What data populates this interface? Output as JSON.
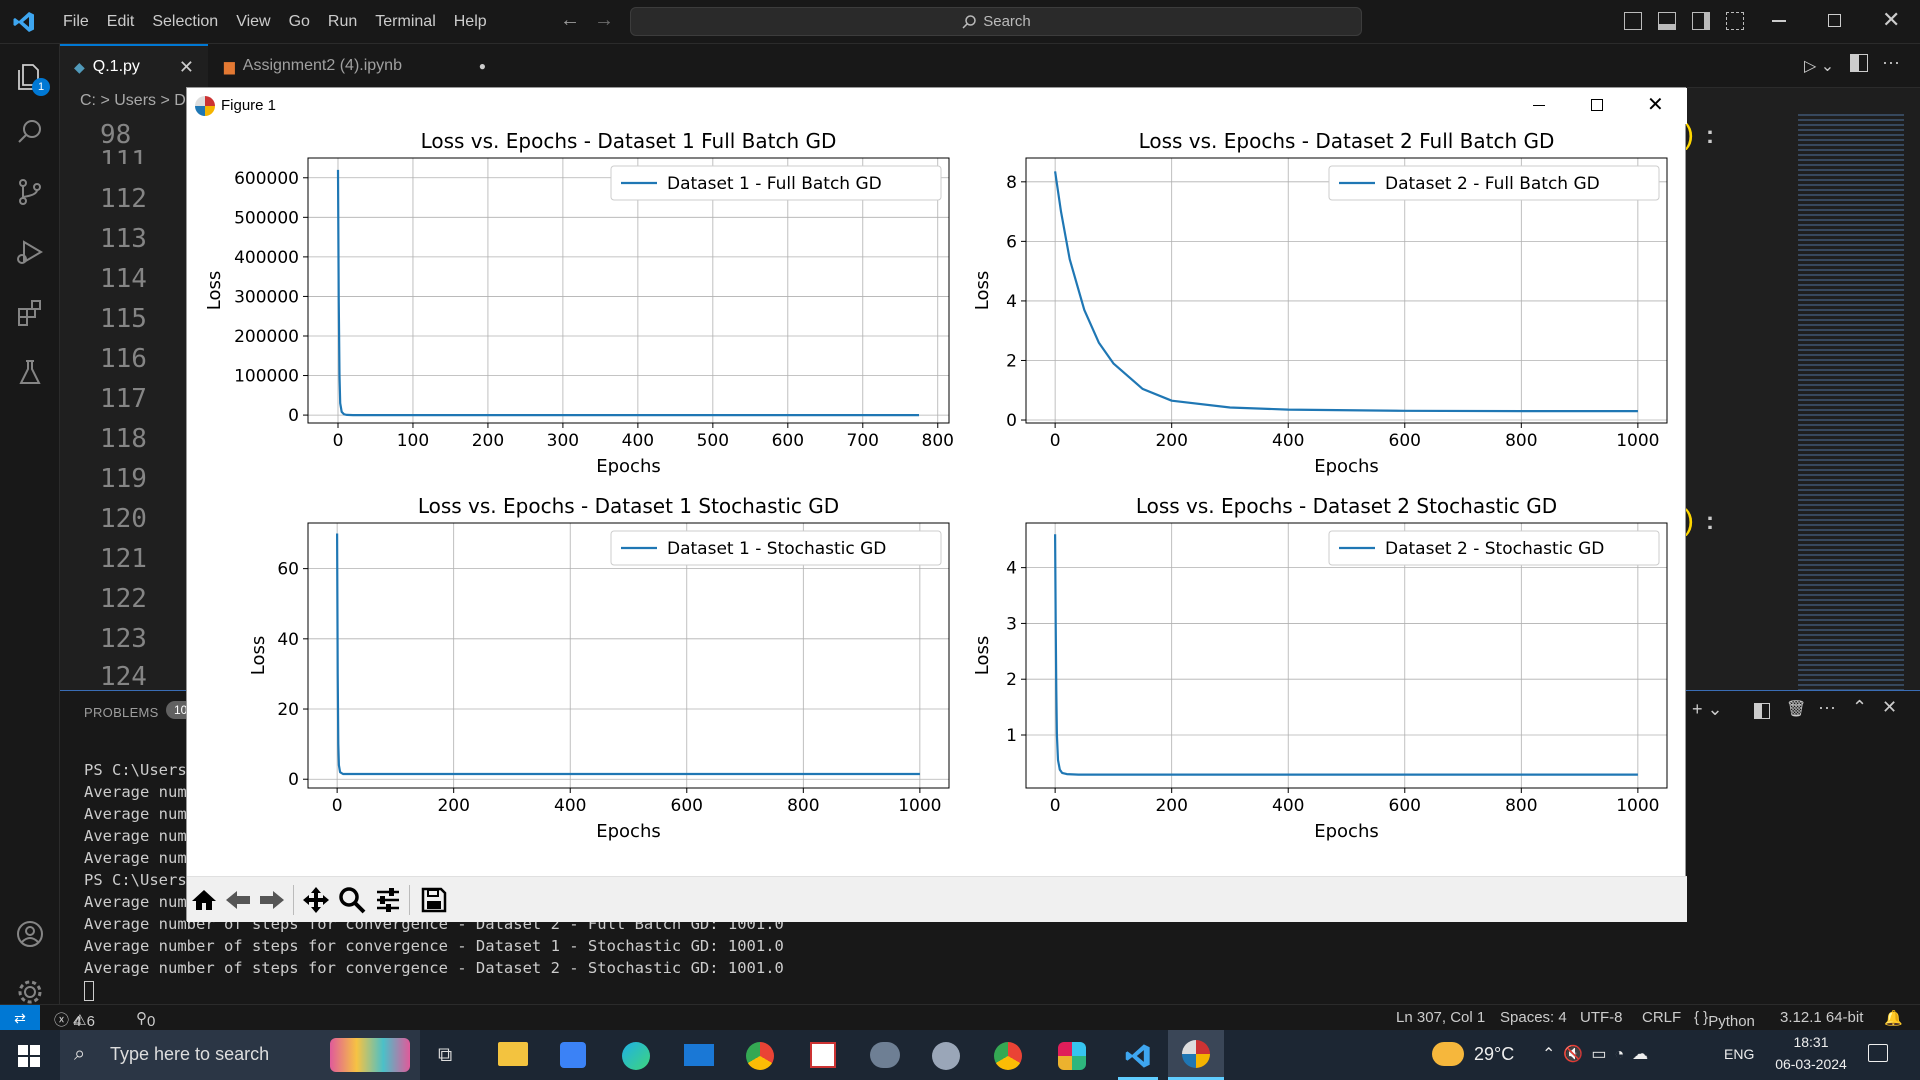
{
  "titlebar": {
    "menu": [
      "File",
      "Edit",
      "Selection",
      "View",
      "Go",
      "Run",
      "Terminal",
      "Help"
    ],
    "search_placeholder": "Search"
  },
  "activity": {
    "explorer_badge": "1"
  },
  "tabs": [
    {
      "label": "Q.1.py",
      "active": true
    },
    {
      "label": "Assignment2 (4).ipynb",
      "active": false
    }
  ],
  "breadcrumb": {
    "items": [
      "C:",
      "Users",
      "D"
    ]
  },
  "editor": {
    "line_numbers": [
      "98",
      "111",
      "112",
      "113",
      "114",
      "115",
      "116",
      "117",
      "118",
      "119",
      "120",
      "121",
      "122",
      "123",
      "124"
    ]
  },
  "panel": {
    "problems_label": "PROBLEMS",
    "problems_count": "10",
    "terminal_lines": [
      "PS C:\\Users",
      "Average num",
      "Average num",
      "Average num",
      "Average num",
      "PS C:\\Users",
      "Average num",
      "Average number of steps for convergence - Dataset 2 - Full Batch GD: 1001.0",
      "Average number of steps for convergence - Dataset 1 - Stochastic GD: 1001.0",
      "Average number of steps for convergence - Dataset 2 - Stochastic GD: 1001.0"
    ]
  },
  "statusbar": {
    "errors": "4",
    "warnings": "6",
    "ports": "0",
    "position": "Ln 307, Col 1",
    "spaces": "Spaces: 4",
    "encoding": "UTF-8",
    "eol": "CRLF",
    "language": "Python",
    "interpreter": "3.12.1 64-bit"
  },
  "taskbar": {
    "search_placeholder": "Type here to search",
    "weather": "29°C",
    "lang": "ENG",
    "time": "18:31",
    "date": "06-03-2024"
  },
  "figure": {
    "window_title": "Figure 1"
  },
  "colors": {
    "series": "#1f77b4",
    "vscode_accent": "#0078d4"
  },
  "chart_data": [
    {
      "type": "line",
      "title": "Loss vs. Epochs - Dataset 1 Full Batch GD",
      "xlabel": "Epochs",
      "ylabel": "Loss",
      "xlim": [
        -40,
        815
      ],
      "ylim": [
        -20000,
        650000
      ],
      "xticks": [
        0,
        100,
        200,
        300,
        400,
        500,
        600,
        700,
        800
      ],
      "yticks": [
        0,
        100000,
        200000,
        300000,
        400000,
        500000,
        600000
      ],
      "legend": "upper right",
      "grid": true,
      "series": [
        {
          "name": "Dataset 1 - Full Batch GD",
          "x": [
            0,
            1,
            2,
            3,
            5,
            8,
            12,
            20,
            100,
            400,
            775
          ],
          "y": [
            620000,
            300000,
            100000,
            30000,
            8000,
            2000,
            500,
            100,
            10,
            5,
            5
          ]
        }
      ]
    },
    {
      "type": "line",
      "title": "Loss vs. Epochs - Dataset 2 Full Batch GD",
      "xlabel": "Epochs",
      "ylabel": "Loss",
      "xlim": [
        -50,
        1050
      ],
      "ylim": [
        -0.1,
        8.8
      ],
      "xticks": [
        0,
        200,
        400,
        600,
        800,
        1000
      ],
      "yticks": [
        0,
        2,
        4,
        6,
        8
      ],
      "legend": "upper right",
      "grid": true,
      "series": [
        {
          "name": "Dataset 2 - Full Batch GD",
          "x": [
            0,
            10,
            25,
            50,
            75,
            100,
            150,
            200,
            300,
            400,
            600,
            800,
            1000
          ],
          "y": [
            8.35,
            7.0,
            5.4,
            3.7,
            2.6,
            1.9,
            1.05,
            0.65,
            0.42,
            0.35,
            0.31,
            0.3,
            0.3
          ]
        }
      ]
    },
    {
      "type": "line",
      "title": "Loss vs. Epochs - Dataset 1 Stochastic GD",
      "xlabel": "Epochs",
      "ylabel": "Loss",
      "xlim": [
        -50,
        1050
      ],
      "ylim": [
        -2.5,
        73
      ],
      "xticks": [
        0,
        200,
        400,
        600,
        800,
        1000
      ],
      "yticks": [
        0,
        20,
        40,
        60
      ],
      "legend": "upper right",
      "grid": true,
      "series": [
        {
          "name": "Dataset 1 - Stochastic GD",
          "x": [
            0,
            1,
            2,
            3,
            5,
            10,
            50,
            1000
          ],
          "y": [
            70,
            30,
            10,
            4,
            2,
            1.5,
            1.5,
            1.5
          ]
        }
      ]
    },
    {
      "type": "line",
      "title": "Loss vs. Epochs - Dataset 2 Stochastic GD",
      "xlabel": "Epochs",
      "ylabel": "Loss",
      "xlim": [
        -50,
        1050
      ],
      "ylim": [
        0.05,
        4.8
      ],
      "xticks": [
        0,
        200,
        400,
        600,
        800,
        1000
      ],
      "yticks": [
        1,
        2,
        3,
        4
      ],
      "legend": "upper right",
      "grid": true,
      "series": [
        {
          "name": "Dataset 2 - Stochastic GD",
          "x": [
            0,
            1,
            2,
            3,
            5,
            8,
            12,
            20,
            40,
            1000
          ],
          "y": [
            4.6,
            3.0,
            1.8,
            1.0,
            0.55,
            0.38,
            0.32,
            0.3,
            0.29,
            0.29
          ]
        }
      ]
    }
  ]
}
